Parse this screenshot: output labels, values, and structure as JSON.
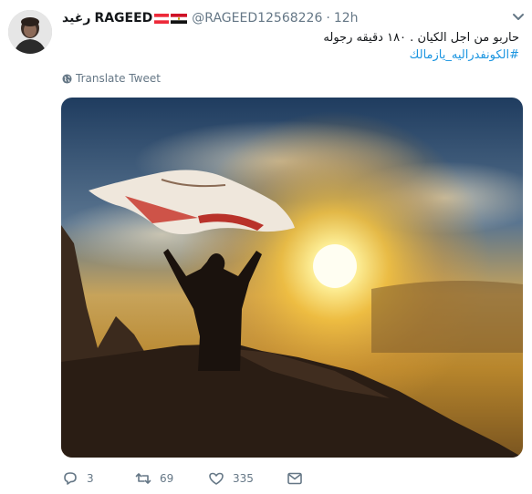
{
  "tweet": {
    "display_name": "RAGEED",
    "display_name_prefix": "رغيد",
    "handle": "@RAGEED12568226",
    "separator": "·",
    "time": "12h",
    "text_line1": "حاربو من اجل الكيان . ١٨٠ دقيقه رجوله",
    "hashtag": "#الكونفدراليه_يازمالك",
    "translate_label": "Translate Tweet"
  },
  "actions": {
    "replies": "3",
    "retweets": "69",
    "likes": "335"
  },
  "icons": {
    "flag_1": "austria-flag-icon",
    "flag_2": "egypt-flag-icon",
    "menu": "chevron-down-icon",
    "translate": "globe-icon",
    "reply": "reply-icon",
    "retweet": "retweet-icon",
    "like": "heart-icon",
    "dm": "envelope-icon"
  },
  "colors": {
    "link": "#1b95e0",
    "secondary_text": "#657786",
    "primary_text": "#14171a"
  }
}
